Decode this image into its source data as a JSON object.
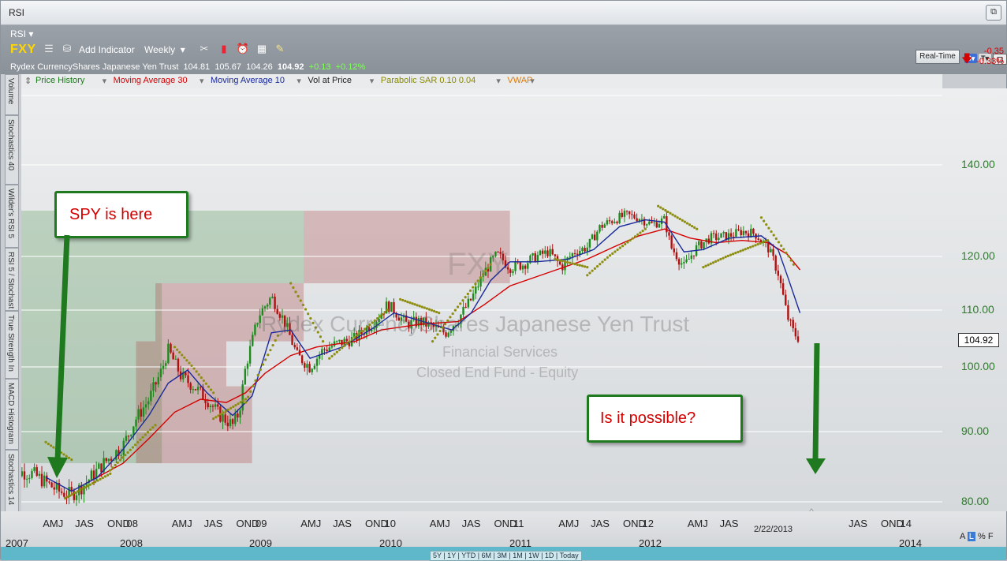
{
  "window": {
    "title": "RSI"
  },
  "header": {
    "rsi_label": "RSI",
    "symbol": "FXY",
    "add_indicator": "Add Indicator",
    "period": "Weekly",
    "quote_name": "Rydex CurrencyShares Japanese Yen Trust",
    "open": "104.81",
    "high": "105.67",
    "low": "104.26",
    "close": "104.92",
    "change": "+0.13",
    "change_pct": "+0.12%",
    "realtime": "Real-Time",
    "right_change": "-0.35",
    "right_change_pct": "-0.33%"
  },
  "studies": [
    {
      "label": "Price History",
      "color": "#1a7a1a"
    },
    {
      "label": "Moving Average 30",
      "color": "#d40000"
    },
    {
      "label": "Moving Average 10",
      "color": "#1a2a9a"
    },
    {
      "label": "Vol at Price",
      "color": "#222222"
    },
    {
      "label": "Parabolic SAR 0.10 0.04",
      "color": "#8a8a00"
    },
    {
      "label": "VWAP",
      "color": "#e07a00"
    }
  ],
  "side_tabs": [
    "Volume",
    "Stochastics 40",
    "Wilder's RSI 5",
    "RSI 5 / Stochast",
    "True Strength In",
    "MACD Histogram",
    "Stochastics 14"
  ],
  "watermark": {
    "symbol": "FXY",
    "name": "Rydex CurrencyShares Japanese Yen Trust",
    "sector": "Financial Services",
    "type": "Closed End Fund - Equity"
  },
  "callouts": {
    "spy": "SPY is here",
    "possible": "Is it possible?"
  },
  "last_price_tag": "104.92",
  "date_marker": "2/22/2013",
  "range_buttons": "5Y | 1Y | YTD | 6M | 3M | 1M | 1W | 1D | Today",
  "scale_buttons": {
    "a": "A",
    "l": "L",
    "p": "%",
    "f": "F"
  },
  "chart_data": {
    "type": "candlestick",
    "title": "",
    "ylim": [
      78,
      150
    ],
    "y_ticks": [
      "140.00",
      "120.00",
      "110.00",
      "100.00",
      "90.00",
      "80.00"
    ],
    "x_ticks": [
      {
        "label": "AMJ",
        "x": 2007.35
      },
      {
        "label": "JAS",
        "x": 2007.6
      },
      {
        "label": "OND",
        "x": 2007.85
      },
      {
        "label": "08",
        "x": 2008.0
      },
      {
        "label": "AMJ",
        "x": 2008.35
      },
      {
        "label": "JAS",
        "x": 2008.6
      },
      {
        "label": "OND",
        "x": 2008.85
      },
      {
        "label": "09",
        "x": 2009.0
      },
      {
        "label": "AMJ",
        "x": 2009.35
      },
      {
        "label": "JAS",
        "x": 2009.6
      },
      {
        "label": "OND",
        "x": 2009.85
      },
      {
        "label": "10",
        "x": 2010.0
      },
      {
        "label": "AMJ",
        "x": 2010.35
      },
      {
        "label": "JAS",
        "x": 2010.6
      },
      {
        "label": "OND",
        "x": 2010.85
      },
      {
        "label": "11",
        "x": 2011.0
      },
      {
        "label": "AMJ",
        "x": 2011.35
      },
      {
        "label": "JAS",
        "x": 2011.6
      },
      {
        "label": "OND",
        "x": 2011.85
      },
      {
        "label": "12",
        "x": 2012.0
      },
      {
        "label": "AMJ",
        "x": 2012.35
      },
      {
        "label": "JAS",
        "x": 2012.6
      },
      {
        "label": "JAS",
        "x": 2013.6
      },
      {
        "label": "OND",
        "x": 2013.85
      },
      {
        "label": "14",
        "x": 2014.0
      }
    ],
    "x_years": [
      "2007",
      "2008",
      "2009",
      "2010",
      "2011",
      "2012",
      "2014"
    ],
    "price_path": [
      [
        2007.0,
        84.5
      ],
      [
        2007.2,
        84.0
      ],
      [
        2007.4,
        81.5
      ],
      [
        2007.5,
        81.0
      ],
      [
        2007.6,
        82.5
      ],
      [
        2007.75,
        85.5
      ],
      [
        2007.9,
        88.0
      ],
      [
        2008.0,
        92.0
      ],
      [
        2008.1,
        95.0
      ],
      [
        2008.2,
        99.5
      ],
      [
        2008.25,
        103.0
      ],
      [
        2008.35,
        98.5
      ],
      [
        2008.45,
        97.0
      ],
      [
        2008.55,
        95.0
      ],
      [
        2008.65,
        92.5
      ],
      [
        2008.75,
        91.0
      ],
      [
        2008.8,
        93.0
      ],
      [
        2008.85,
        100.0
      ],
      [
        2008.95,
        109.0
      ],
      [
        2009.05,
        112.5
      ],
      [
        2009.15,
        108.0
      ],
      [
        2009.25,
        102.0
      ],
      [
        2009.35,
        100.0
      ],
      [
        2009.45,
        103.0
      ],
      [
        2009.55,
        104.0
      ],
      [
        2009.7,
        105.0
      ],
      [
        2009.85,
        108.0
      ],
      [
        2009.95,
        111.0
      ],
      [
        2010.0,
        110.0
      ],
      [
        2010.1,
        107.5
      ],
      [
        2010.2,
        108.0
      ],
      [
        2010.3,
        107.0
      ],
      [
        2010.4,
        106.0
      ],
      [
        2010.5,
        108.5
      ],
      [
        2010.6,
        112.0
      ],
      [
        2010.7,
        117.0
      ],
      [
        2010.8,
        120.5
      ],
      [
        2010.9,
        118.0
      ],
      [
        2011.0,
        118.5
      ],
      [
        2011.1,
        120.0
      ],
      [
        2011.2,
        121.0
      ],
      [
        2011.3,
        118.0
      ],
      [
        2011.4,
        121.0
      ],
      [
        2011.5,
        122.0
      ],
      [
        2011.6,
        126.5
      ],
      [
        2011.7,
        128.0
      ],
      [
        2011.8,
        129.0
      ],
      [
        2011.9,
        128.5
      ],
      [
        2012.0,
        127.0
      ],
      [
        2012.1,
        128.0
      ],
      [
        2012.15,
        122.0
      ],
      [
        2012.25,
        118.0
      ],
      [
        2012.35,
        122.0
      ],
      [
        2012.45,
        124.0
      ],
      [
        2012.6,
        124.5
      ],
      [
        2012.7,
        125.5
      ],
      [
        2012.8,
        125.0
      ],
      [
        2012.9,
        122.0
      ],
      [
        2012.98,
        117.0
      ],
      [
        2013.05,
        109.0
      ],
      [
        2013.1,
        106.0
      ],
      [
        2013.15,
        104.92
      ]
    ],
    "ma30_path": [
      [
        2007.6,
        82.5
      ],
      [
        2007.9,
        85.5
      ],
      [
        2008.1,
        89.0
      ],
      [
        2008.3,
        93.0
      ],
      [
        2008.5,
        95.0
      ],
      [
        2008.7,
        94.5
      ],
      [
        2008.85,
        96.0
      ],
      [
        2009.0,
        99.0
      ],
      [
        2009.2,
        102.0
      ],
      [
        2009.4,
        103.5
      ],
      [
        2009.7,
        104.5
      ],
      [
        2009.9,
        106.5
      ],
      [
        2010.2,
        107.5
      ],
      [
        2010.5,
        108.0
      ],
      [
        2010.7,
        111.0
      ],
      [
        2010.9,
        114.5
      ],
      [
        2011.2,
        117.0
      ],
      [
        2011.5,
        119.5
      ],
      [
        2011.7,
        122.0
      ],
      [
        2011.9,
        124.5
      ],
      [
        2012.1,
        126.0
      ],
      [
        2012.3,
        124.0
      ],
      [
        2012.5,
        123.0
      ],
      [
        2012.7,
        123.5
      ],
      [
        2012.9,
        123.0
      ],
      [
        2013.05,
        120.5
      ],
      [
        2013.15,
        117.5
      ]
    ],
    "ma10_path": [
      [
        2007.3,
        83.5
      ],
      [
        2007.5,
        81.5
      ],
      [
        2007.7,
        83.5
      ],
      [
        2007.9,
        87.5
      ],
      [
        2008.1,
        92.5
      ],
      [
        2008.25,
        97.5
      ],
      [
        2008.4,
        99.5
      ],
      [
        2008.55,
        96.0
      ],
      [
        2008.75,
        92.5
      ],
      [
        2008.9,
        95.5
      ],
      [
        2009.05,
        106.0
      ],
      [
        2009.2,
        106.5
      ],
      [
        2009.35,
        101.5
      ],
      [
        2009.6,
        103.5
      ],
      [
        2009.85,
        107.0
      ],
      [
        2010.0,
        109.5
      ],
      [
        2010.3,
        107.5
      ],
      [
        2010.45,
        106.5
      ],
      [
        2010.6,
        109.5
      ],
      [
        2010.75,
        115.5
      ],
      [
        2010.9,
        119.0
      ],
      [
        2011.1,
        119.0
      ],
      [
        2011.35,
        119.5
      ],
      [
        2011.55,
        121.5
      ],
      [
        2011.75,
        126.5
      ],
      [
        2011.95,
        128.0
      ],
      [
        2012.1,
        127.5
      ],
      [
        2012.25,
        121.0
      ],
      [
        2012.4,
        121.5
      ],
      [
        2012.6,
        124.0
      ],
      [
        2012.85,
        124.5
      ],
      [
        2012.98,
        121.5
      ],
      [
        2013.05,
        116.5
      ],
      [
        2013.15,
        109.5
      ]
    ],
    "sar_segments": [
      [
        [
          2007.3,
          88.5
        ],
        [
          2007.5,
          86.0
        ]
      ],
      [
        [
          2007.45,
          80.5
        ],
        [
          2007.8,
          84.0
        ]
      ],
      [
        [
          2007.8,
          84.5
        ],
        [
          2008.15,
          91.0
        ]
      ],
      [
        [
          2008.3,
          103.5
        ],
        [
          2008.6,
          96.0
        ]
      ],
      [
        [
          2008.6,
          92.0
        ],
        [
          2008.85,
          95.0
        ]
      ],
      [
        [
          2008.85,
          94.5
        ],
        [
          2009.1,
          105.5
        ]
      ],
      [
        [
          2009.2,
          115.0
        ],
        [
          2009.45,
          104.5
        ]
      ],
      [
        [
          2009.5,
          101.5
        ],
        [
          2009.95,
          110.0
        ]
      ],
      [
        [
          2010.05,
          112.0
        ],
        [
          2010.35,
          109.5
        ]
      ],
      [
        [
          2010.3,
          104.5
        ],
        [
          2010.75,
          118.5
        ]
      ],
      [
        [
          2011.25,
          119.5
        ],
        [
          2011.5,
          118.0
        ]
      ],
      [
        [
          2011.5,
          116.5
        ],
        [
          2011.95,
          126.0
        ]
      ],
      [
        [
          2012.05,
          131.0
        ],
        [
          2012.35,
          126.0
        ]
      ],
      [
        [
          2012.4,
          118.0
        ],
        [
          2012.9,
          123.5
        ]
      ],
      [
        [
          2012.85,
          128.5
        ],
        [
          2013.1,
          118.5
        ]
      ]
    ],
    "shaded_zones": [
      {
        "x": [
          2006.95,
          2008.2
        ],
        "y": [
          85.5,
          130.0
        ],
        "kind": "green"
      },
      {
        "x": [
          2008.2,
          2009.3
        ],
        "y": [
          115.0,
          130.0
        ],
        "kind": "green"
      },
      {
        "x": [
          2009.3,
          2010.9
        ],
        "y": [
          115.0,
          130.0
        ],
        "kind": "red"
      },
      {
        "x": [
          2008.15,
          2009.3
        ],
        "y": [
          104.5,
          115.0
        ],
        "kind": "red"
      },
      {
        "x": [
          2008.0,
          2008.7
        ],
        "y": [
          85.5,
          104.5
        ],
        "kind": "red"
      },
      {
        "x": [
          2008.7,
          2008.9
        ],
        "y": [
          85.5,
          97.0
        ],
        "kind": "red"
      }
    ]
  }
}
